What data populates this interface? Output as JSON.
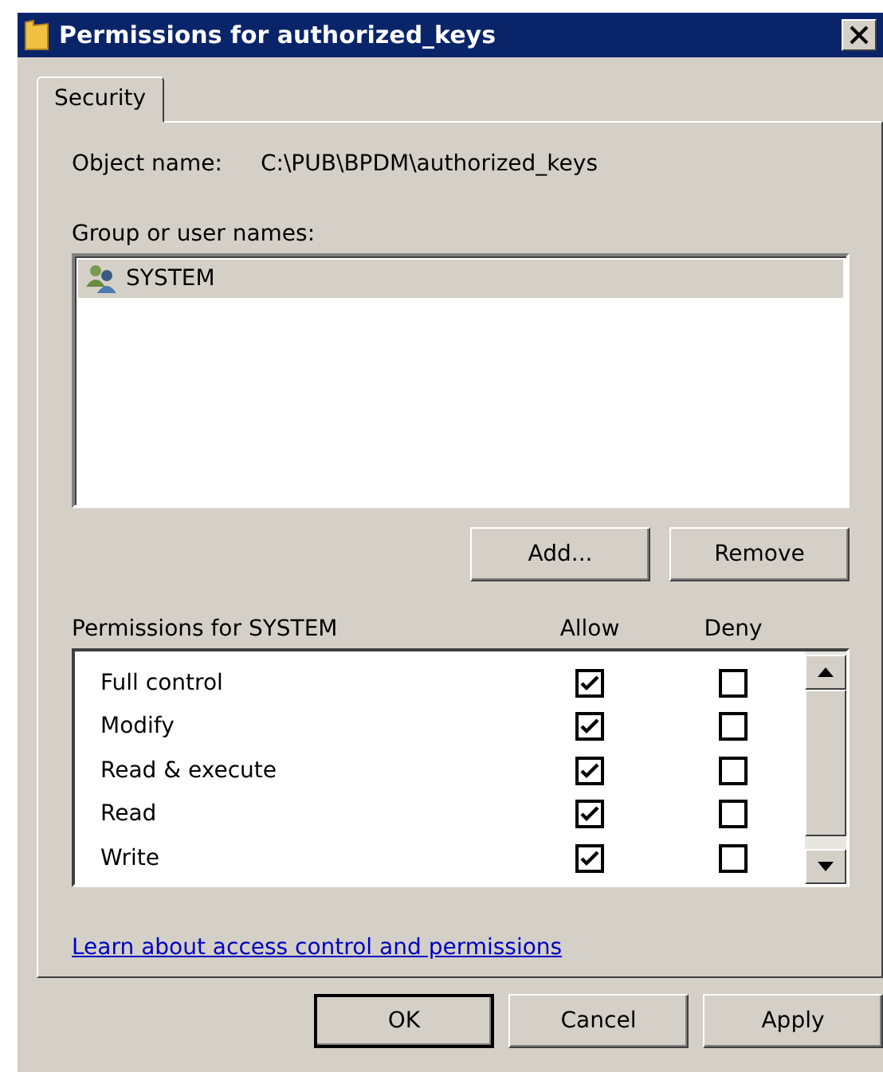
{
  "window": {
    "title": "Permissions for authorized_keys"
  },
  "tabs": [
    {
      "label": "Security",
      "selected": true
    }
  ],
  "object_name": {
    "label": "Object name:",
    "value": "C:\\PUB\\BPDM\\authorized_keys"
  },
  "group_list": {
    "label": "Group or user names:",
    "items": [
      {
        "name": "SYSTEM",
        "selected": true
      }
    ]
  },
  "group_buttons": [
    "Add...",
    "Remove"
  ],
  "permissions": {
    "label": "Permissions for SYSTEM",
    "allow_header": "Allow",
    "deny_header": "Deny",
    "rows": [
      {
        "name": "Full control",
        "allow": true,
        "deny": false
      },
      {
        "name": "Modify",
        "allow": true,
        "deny": false
      },
      {
        "name": "Read & execute",
        "allow": true,
        "deny": false
      },
      {
        "name": "Read",
        "allow": true,
        "deny": false
      },
      {
        "name": "Write",
        "allow": true,
        "deny": false
      }
    ]
  },
  "link": "Learn about access control and permissions",
  "buttons": [
    {
      "label": "OK",
      "default": true
    },
    {
      "label": "Cancel",
      "default": false
    },
    {
      "label": "Apply",
      "default": false
    }
  ]
}
